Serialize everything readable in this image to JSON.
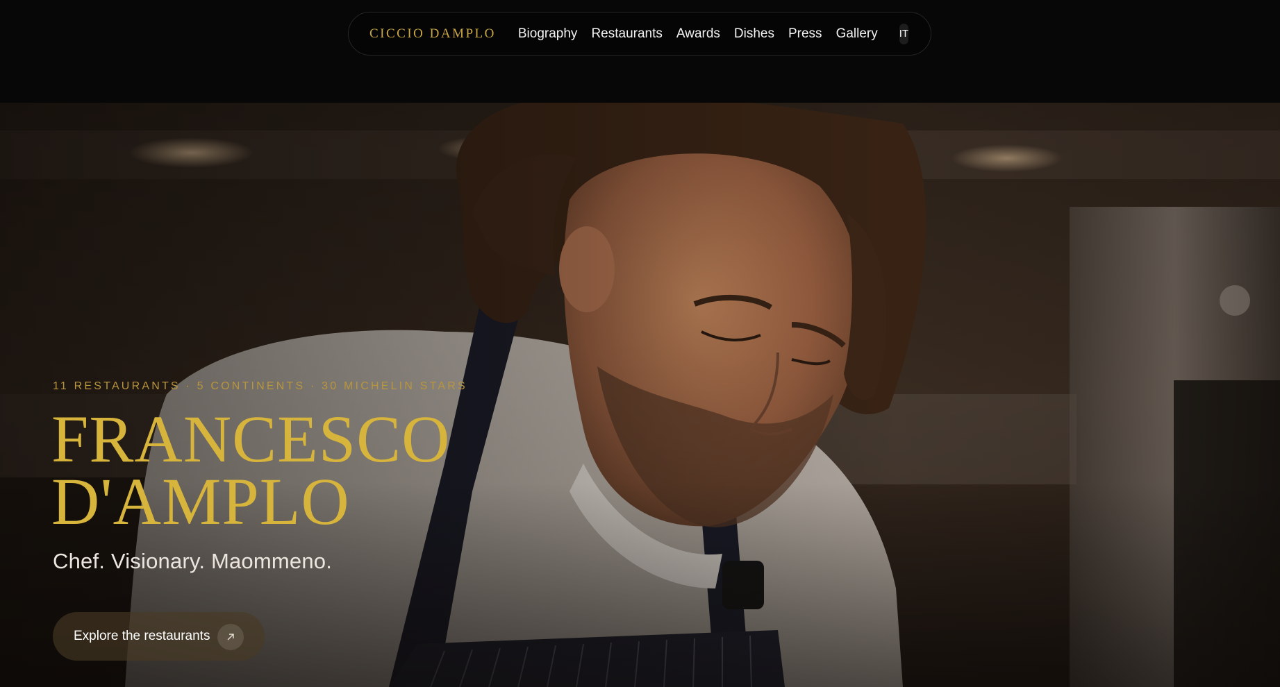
{
  "nav": {
    "brand": "CICCIO DAMPLO",
    "links": [
      "Biography",
      "Restaurants",
      "Awards",
      "Dishes",
      "Press",
      "Gallery"
    ],
    "lang": "IT"
  },
  "hero": {
    "kicker": "11 RESTAURANTS · 5 CONTINENTS · 30 MICHELIN STARS",
    "title_line1": "FRANCESCO",
    "title_line2": "D'AMPLO",
    "subtitle": "Chef. Visionary. Maommeno.",
    "cta_label": "Explore the restaurants",
    "cta_icon": "arrow-up-right-icon"
  },
  "colors": {
    "accent_gold": "#d7b43c",
    "brand_gold": "#c9a646",
    "background": "#070707"
  }
}
